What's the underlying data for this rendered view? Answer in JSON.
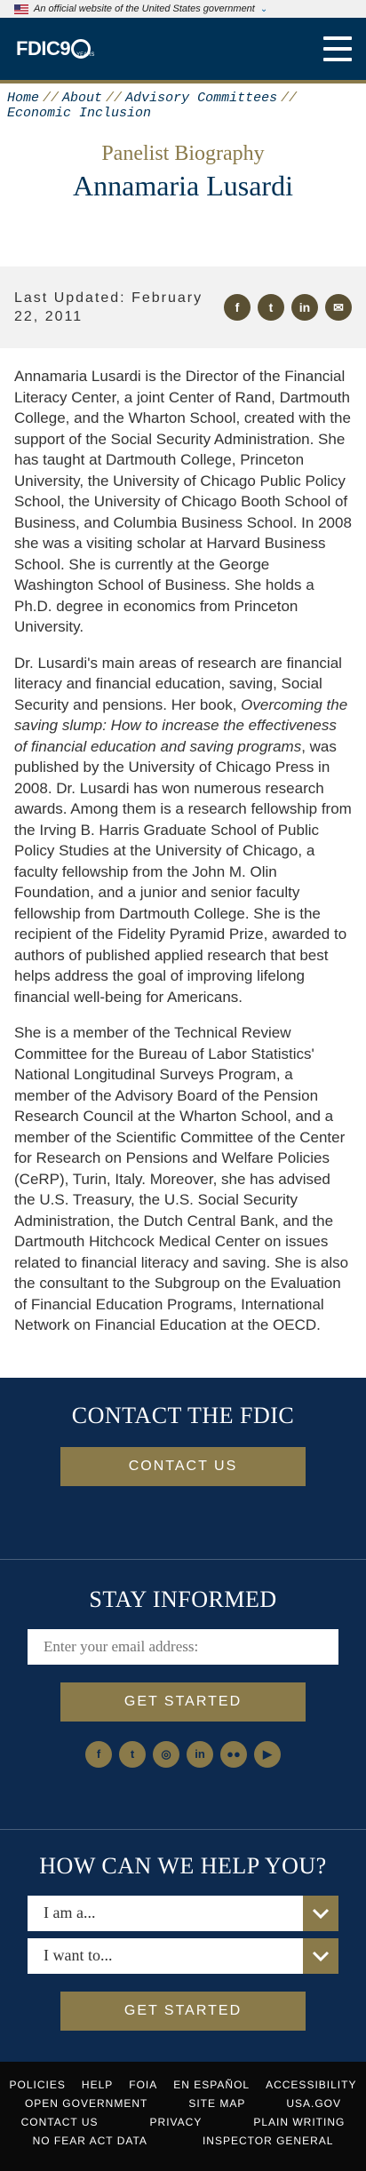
{
  "gov_banner": {
    "text": "An official website of the United States government"
  },
  "header": {
    "logo_text": "FDIC9",
    "logo_sub": "YEARS"
  },
  "breadcrumb": [
    {
      "label": "Home"
    },
    {
      "label": "About"
    },
    {
      "label": "Advisory Committees"
    },
    {
      "label": "Economic Inclusion"
    }
  ],
  "page": {
    "kicker": "Panelist Biography",
    "name": "Annamaria Lusardi",
    "updated": "Last Updated: February 22, 2011"
  },
  "share": {
    "facebook": "f",
    "twitter": "t",
    "linkedin": "in",
    "email": "✉"
  },
  "bio": {
    "p1": "Annamaria Lusardi is the Director of the Financial Literacy Center, a joint Center of Rand, Dartmouth College, and the Wharton School, created with the support of the Social Security Administration.  She has taught at Dartmouth College, Princeton University, the University of Chicago Public Policy School, the University of Chicago Booth School of Business, and Columbia Business School. In 2008 she was a visiting scholar at Harvard Business School. She is currently at the George Washington School of Business. She holds a Ph.D. degree in economics from Princeton University.",
    "p2_before": "Dr. Lusardi's main areas of research are financial literacy and financial education, saving, Social Security and pensions. Her book, ",
    "p2_em": "Overcoming the saving slump: How to increase the effectiveness of financial education and saving programs",
    "p2_after": ", was published by the University of Chicago Press in 2008. Dr. Lusardi has won numerous research awards. Among them is a research fellowship from the Irving B. Harris Graduate School of Public Policy Studies at the University of Chicago, a faculty fellowship from the John M. Olin Foundation, and a junior and senior faculty fellowship from Dartmouth College. She is the recipient of the Fidelity Pyramid Prize, awarded to authors of published applied research that best helps address the goal of improving lifelong financial well-being for Americans.",
    "p3": "She is a member of the Technical Review Committee for the Bureau of Labor Statistics' National Longitudinal Surveys Program, a member of the Advisory Board of the Pension Research Council at the Wharton School, and a member of the Scientific Committee of the Center for Research on Pensions and Welfare Policies (CeRP), Turin, Italy. Moreover, she has advised the U.S. Treasury, the U.S. Social Security Administration, the Dutch Central Bank, and the Dartmouth Hitchcock Medical Center on issues related to financial literacy and saving.  She is also the consultant to the Subgroup on the Evaluation of Financial Education Programs, International Network on Financial Education at the OECD."
  },
  "contact": {
    "title": "CONTACT THE FDIC",
    "button": "CONTACT US"
  },
  "stay": {
    "title": "STAY INFORMED",
    "email_placeholder": "Enter your email address:",
    "button": "GET STARTED",
    "social": [
      "f",
      "t",
      "◎",
      "in",
      "●●",
      "▶"
    ]
  },
  "help": {
    "title": "HOW CAN WE HELP YOU?",
    "select1": "I am a...",
    "select2": "I want to...",
    "button": "GET STARTED"
  },
  "footer_links": {
    "row1": [
      "POLICIES",
      "HELP",
      "FOIA",
      "EN ESPAÑOL",
      "ACCESSIBILITY"
    ],
    "row2": [
      "OPEN GOVERNMENT",
      "SITE MAP",
      "USA.GOV"
    ],
    "row3": [
      "CONTACT US",
      "PRIVACY",
      "PLAIN WRITING"
    ],
    "row4": [
      "NO FEAR ACT DATA",
      "INSPECTOR GENERAL"
    ]
  },
  "colors": {
    "navy": "#003256",
    "gold": "#8a7a4a",
    "footer_bg": "#0d2a4f"
  }
}
